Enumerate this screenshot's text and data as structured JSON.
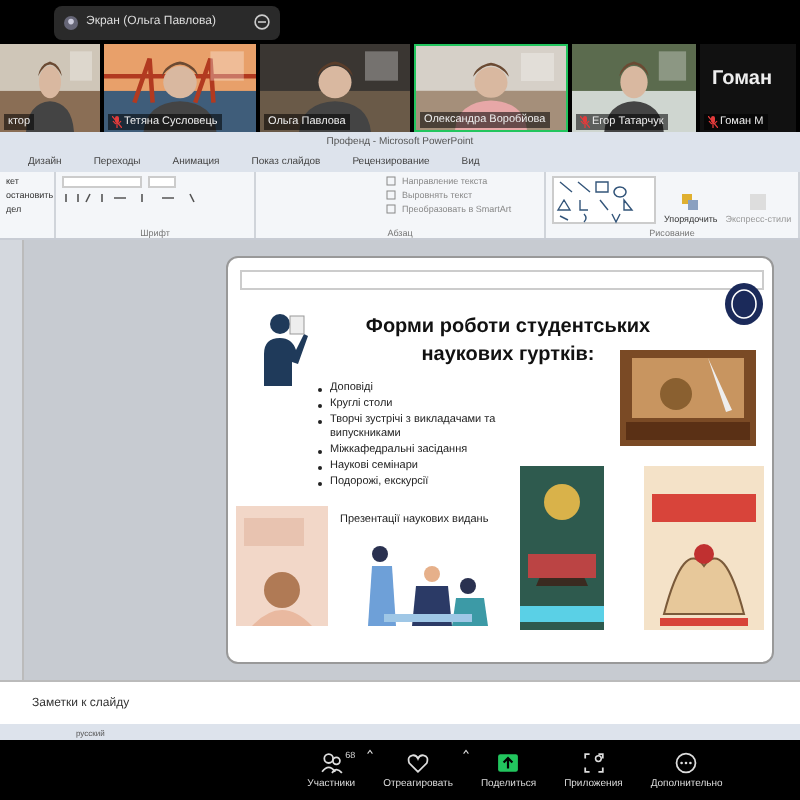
{
  "share_banner": {
    "label": "Экран (Ольга Павлова)"
  },
  "participants": [
    {
      "kind": "video",
      "name": "ктор",
      "muted": false,
      "active": false
    },
    {
      "kind": "video",
      "name": "Тетяна Сусловець",
      "muted": true,
      "active": false
    },
    {
      "kind": "video",
      "name": "Ольга Павлова",
      "muted": false,
      "active": false
    },
    {
      "kind": "video",
      "name": "Олександра Воробйова",
      "muted": false,
      "active": true
    },
    {
      "kind": "video",
      "name": "Егор Татарчук",
      "muted": true,
      "active": false
    },
    {
      "kind": "name_only",
      "display": "Гоман",
      "name": "Гоман М",
      "muted": true,
      "active": false
    }
  ],
  "ppt": {
    "title": "Профенд - Microsoft PowerPoint",
    "tabs": [
      {
        "label": "Дизайн",
        "selected": false
      },
      {
        "label": "Переходы",
        "selected": false
      },
      {
        "label": "Анимация",
        "selected": false
      },
      {
        "label": "Показ слайдов",
        "selected": false
      },
      {
        "label": "Рецензирование",
        "selected": false
      },
      {
        "label": "Вид",
        "selected": false
      }
    ],
    "clipboard_items": [
      "кет",
      "остановить",
      "дел"
    ],
    "paragraph_items": [
      "Направление текста",
      "Выровнять текст",
      "Преобразовать в SmartArt"
    ],
    "drawing_items": [
      "Упорядочить",
      "Экспресс-стили"
    ],
    "group_labels": [
      "Шрифт",
      "Абзац",
      "Рисование"
    ],
    "slide": {
      "title": "Форми роботи студентських наукових гуртків:",
      "bullets": [
        "Доповіді",
        "Круглі столи",
        "Творчі зустрічі з викладачами та випускниками",
        "Міжкафедральні засідання",
        "Наукові семінари",
        "Подорожі, екскурсії"
      ],
      "footer_line": "Презентації наукових видань"
    },
    "notes_placeholder": "Заметки к слайду",
    "language": "русский"
  },
  "toolbar": [
    {
      "kind": "participants",
      "label": "Участники",
      "count": "68",
      "caret": true
    },
    {
      "kind": "react",
      "label": "Отреагировать",
      "caret": true
    },
    {
      "kind": "share",
      "label": "Поделиться",
      "caret": false
    },
    {
      "kind": "apps",
      "label": "Приложения",
      "caret": false
    },
    {
      "kind": "more",
      "label": "Дополнительно",
      "caret": false
    }
  ]
}
